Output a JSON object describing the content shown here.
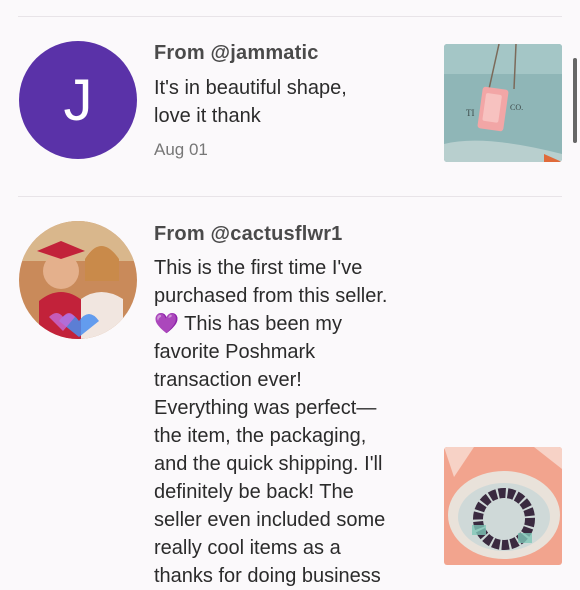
{
  "reviews": [
    {
      "from": "From @jammatic",
      "avatar_letter": "J",
      "text_lines": [
        "It's in beautiful shape,",
        "love it thank"
      ],
      "date": "Aug 01",
      "thumb_icon": "necklace-photo",
      "thumb_text_left": "TI",
      "thumb_text_right": "CO."
    },
    {
      "from": "From @cactusflwr1",
      "avatar_icon": "profile-photo",
      "text_lines": [
        "This is the first time I've",
        "purchased from this seller.",
        "💜 This has been my",
        "favorite Poshmark",
        "transaction ever!",
        "Everything was perfect—",
        "the item, the packaging,",
        "and the quick shipping. I'll",
        "definitely be back! The",
        "seller even included some",
        "really cool items as a",
        "thanks for doing business"
      ],
      "thumb_icon": "bracelet-photo"
    }
  ],
  "colors": {
    "avatar_purple": "#5a32a8",
    "background": "#fbf9fb"
  }
}
